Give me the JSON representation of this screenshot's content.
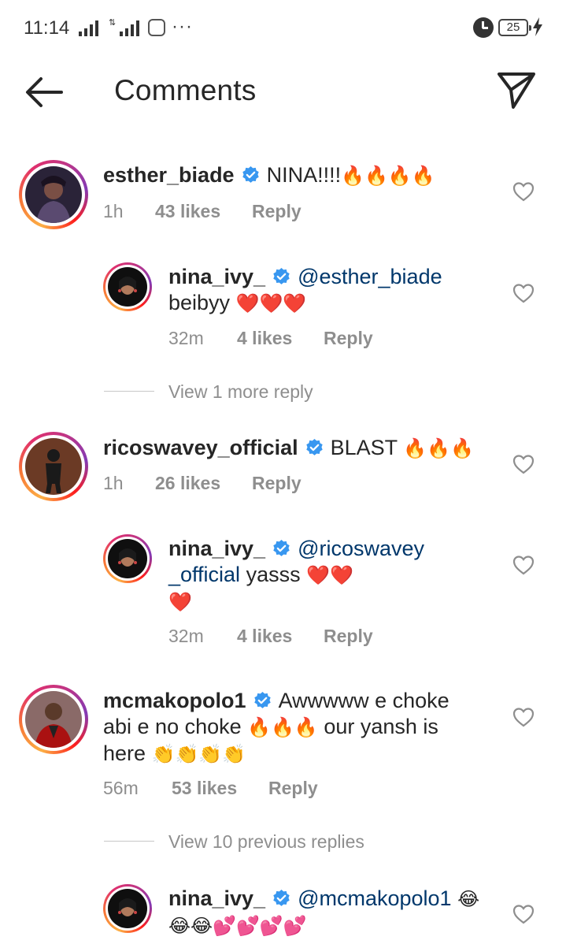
{
  "status_bar": {
    "time": "11:14",
    "battery": "25",
    "icons": [
      "signal-icon",
      "signal-icon",
      "app-icon",
      "more-icon",
      "alarm-icon",
      "battery-icon",
      "charging-icon"
    ]
  },
  "header": {
    "title": "Comments",
    "back_icon": "arrow-left-icon",
    "send_icon": "paper-plane-icon"
  },
  "comments": [
    {
      "username": "esther_biade",
      "verified": true,
      "text": "NINA!!!!",
      "emojis": "🔥🔥🔥🔥",
      "time": "1h",
      "likes": "43 likes",
      "reply_label": "Reply",
      "replies": [
        {
          "username": "nina_ivy_",
          "verified": true,
          "mention": "@esther_biade",
          "text": "beibyy",
          "emojis": "❤️❤️❤️",
          "time": "32m",
          "likes": "4 likes",
          "reply_label": "Reply"
        }
      ],
      "view_more": "View 1 more reply"
    },
    {
      "username": "ricoswavey_official",
      "verified": true,
      "text": "BLAST",
      "emojis": "🔥🔥🔥",
      "time": "1h",
      "likes": "26 likes",
      "reply_label": "Reply",
      "replies": [
        {
          "username": "nina_ivy_",
          "verified": true,
          "mention_part1": "@ricoswavey",
          "mention_part2": "_official",
          "text": "yasss",
          "emojis_line1": "❤️❤️",
          "emojis_line2": "❤️",
          "time": "32m",
          "likes": "4 likes",
          "reply_label": "Reply"
        }
      ]
    },
    {
      "username": "mcmakopolo1",
      "verified": true,
      "text_part1": "Awwwww e choke",
      "text_part2": "abi e no choke",
      "emojis_mid": "🔥🔥🔥",
      "text_part3": "our yansh is",
      "text_part4": "here",
      "emojis_end": "👏👏👏👏",
      "time": "56m",
      "likes": "53 likes",
      "reply_label": "Reply",
      "view_previous": "View 10 previous replies",
      "replies": [
        {
          "username": "nina_ivy_",
          "verified": true,
          "mention": "@mcmakopolo1",
          "emojis_line1": "😂",
          "emojis_line2": "😂😂💕💕💕💕"
        }
      ]
    }
  ],
  "colors": {
    "text": "#262626",
    "secondary": "#8e8e8e",
    "mention": "#00376b",
    "verified": "#3897f0"
  }
}
